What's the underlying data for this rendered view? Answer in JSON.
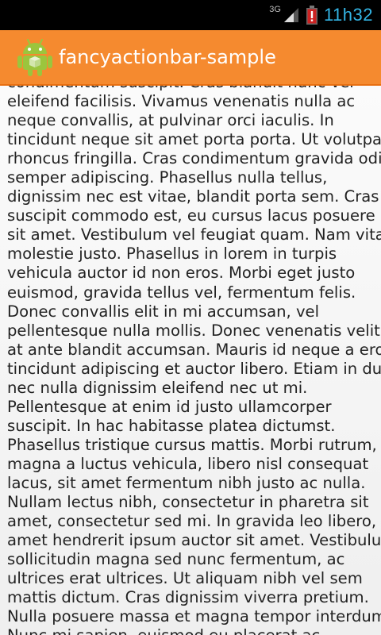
{
  "status_bar": {
    "network": "3G",
    "time": "11h32"
  },
  "action_bar": {
    "app_icon": "android-icon",
    "title": "fancyactionbar-sample"
  },
  "content": {
    "lines": [
      "condimentum suscipit. Cras blandit nunc vel",
      "eleifend facilisis. Vivamus venenatis nulla ac",
      "neque convallis, at pulvinar orci iaculis. In",
      "tincidunt neque sit amet porta porta. Ut volutpat",
      "rhoncus fringilla. Cras condimentum gravida odio",
      "semper adipiscing. Phasellus nulla tellus,",
      "dignissim nec est vitae, blandit porta sem. Cras",
      "suscipit commodo est, eu cursus lacus posuere",
      "sit amet. Vestibulum vel feugiat quam. Nam vitae",
      "molestie justo.  Phasellus in lorem in turpis",
      "vehicula auctor id non eros. Morbi eget justo",
      "euismod, gravida tellus vel, fermentum felis.",
      "Donec convallis elit in mi accumsan, vel",
      "pellentesque nulla mollis. Donec venenatis velit",
      "at ante blandit accumsan. Mauris id neque a eros",
      "tincidunt adipiscing et auctor libero. Etiam in dui",
      "nec nulla dignissim eleifend nec ut mi.",
      "Pellentesque at enim id justo ullamcorper",
      "suscipit. In hac habitasse platea dictumst.",
      "Phasellus tristique cursus mattis. Morbi rutrum,",
      "magna a luctus vehicula, libero nisl consequat",
      "lacus, sit amet fermentum nibh justo ac nulla.",
      "Nullam lectus nibh, consectetur in pharetra sit",
      "amet, consectetur sed mi. In gravida leo libero, sit",
      "amet hendrerit ipsum auctor sit amet. Vestibulum",
      "sollicitudin magna sed nunc fermentum, ac",
      "ultrices erat ultrices. Ut aliquam nibh vel sem",
      "mattis dictum. Cras dignissim viverra pretium.",
      "Nulla posuere massa et magna tempor interdum.",
      "Nunc mi sapien, euismod eu placerat ac,"
    ]
  },
  "colors": {
    "action_bar": "#f58a2f",
    "status_text": "#33b5e5",
    "battery_alert": "#cc2222"
  }
}
